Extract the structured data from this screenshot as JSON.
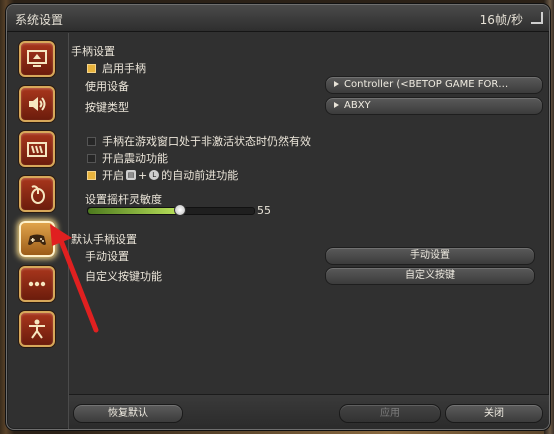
{
  "window": {
    "title": "系统设置",
    "fps": "16帧/秒"
  },
  "sidebar": {
    "items": [
      {
        "icon": "monitor-icon"
      },
      {
        "icon": "speaker-icon"
      },
      {
        "icon": "hotbar-icon"
      },
      {
        "icon": "mouse-icon"
      },
      {
        "icon": "gamepad-icon",
        "active": true
      },
      {
        "icon": "more-icon"
      },
      {
        "icon": "character-icon"
      }
    ]
  },
  "gamepad_settings": {
    "section_title": "手柄设置",
    "enable_label": "启用手柄",
    "enable_checked": true,
    "device_label": "使用设备",
    "device_value": "Controller (<BETOP GAME FOR…",
    "button_type_label": "按键类型",
    "button_type_value": "ABXY",
    "inactive_label": "手柄在游戏窗口处于非激活状态时仍然有效",
    "inactive_checked": false,
    "vibration_label": "开启震动功能",
    "vibration_checked": false,
    "auto_run_prefix": "开启",
    "auto_run_key1": "▤",
    "auto_run_plus": "+",
    "auto_run_key2": "L",
    "auto_run_suffix": "的自动前进功能",
    "auto_run_checked": true,
    "sensitivity_label": "设置摇杆灵敏度",
    "sensitivity_value": "55",
    "sensitivity_fraction": 0.55
  },
  "default_settings": {
    "section_title": "默认手柄设置",
    "manual_label": "手动设置",
    "manual_button": "手动设置",
    "custom_label": "自定义按键功能",
    "custom_button": "自定义按键"
  },
  "footer": {
    "restore_label": "恢复默认",
    "apply_label": "应用",
    "close_label": "关闭"
  },
  "colors": {
    "accent": "#e8b33c",
    "annotation_arrow": "#e02020"
  }
}
